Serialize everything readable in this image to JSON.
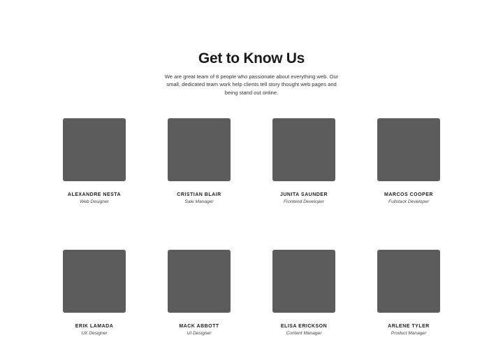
{
  "section": {
    "title": "Get to Know Us",
    "intro": "We are great team of 8 people who passionate about everything web. Our small, dedicated team work help clients tell story thought web pages and being stand out online."
  },
  "team": [
    {
      "name": "ALEXANDRE NESTA",
      "role": "Web Designer"
    },
    {
      "name": "CRISTIAN BLAIR",
      "role": "Sale Manager"
    },
    {
      "name": "JUNITA SAUNDER",
      "role": "Frontend Developer"
    },
    {
      "name": "MARCOS COOPER",
      "role": "Fullstack Developer"
    },
    {
      "name": "ERIK LAMADA",
      "role": "UX Designer"
    },
    {
      "name": "MACK ABBOTT",
      "role": "UI Designer"
    },
    {
      "name": "ELISA ERICKSON",
      "role": "Content Manager"
    },
    {
      "name": "ARLENE TYLER",
      "role": "Product Manager"
    }
  ],
  "colors": {
    "photo_placeholder": "#5c5c5c",
    "background": "#ffffff",
    "text": "#222222"
  }
}
